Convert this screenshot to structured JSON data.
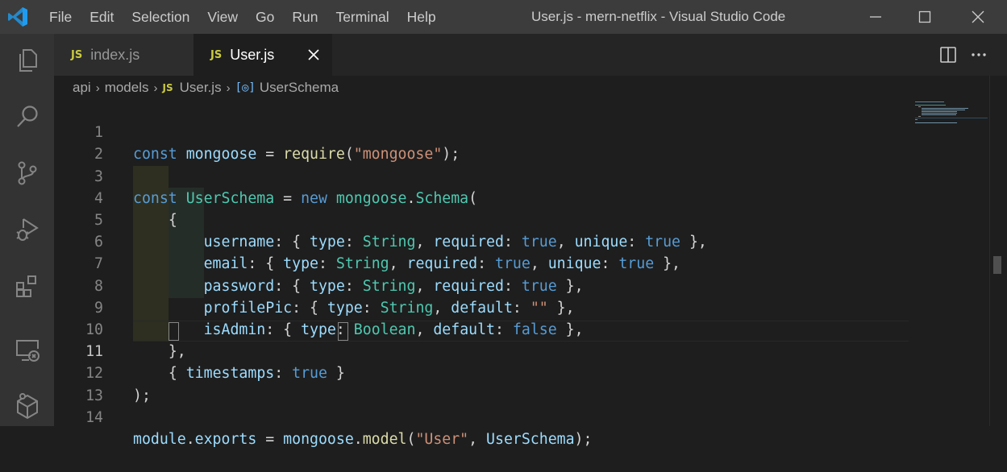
{
  "titlebar": {
    "menu": [
      "File",
      "Edit",
      "Selection",
      "View",
      "Go",
      "Run",
      "Terminal",
      "Help"
    ],
    "window_title": "User.js - mern-netflix - Visual Studio Code"
  },
  "activity_bar": [
    "explorer-icon",
    "search-icon",
    "source-control-icon",
    "run-debug-icon",
    "extensions-icon",
    "remote-explorer-icon",
    "docker-icon"
  ],
  "tabs": [
    {
      "icon": "JS",
      "label": "index.js",
      "active": false
    },
    {
      "icon": "JS",
      "label": "User.js",
      "active": true
    }
  ],
  "breadcrumb": {
    "folder1": "api",
    "folder2": "models",
    "file_icon": "JS",
    "file": "User.js",
    "symbol_icon": "[◎]",
    "symbol": "UserSchema"
  },
  "editor": {
    "current_line": 11,
    "lines": [
      {
        "n": "1",
        "text": "const mongoose = require(\"mongoose\");"
      },
      {
        "n": "2",
        "text": ""
      },
      {
        "n": "3",
        "text": "const UserSchema = new mongoose.Schema("
      },
      {
        "n": "4",
        "text": "    {"
      },
      {
        "n": "5",
        "text": "        username: { type: String, required: true, unique: true },"
      },
      {
        "n": "6",
        "text": "        email: { type: String, required: true, unique: true },"
      },
      {
        "n": "7",
        "text": "        password: { type: String, required: true },"
      },
      {
        "n": "8",
        "text": "        profilePic: { type: String, default: \"\" },"
      },
      {
        "n": "9",
        "text": "        isAdmin: { type: Boolean, default: false },"
      },
      {
        "n": "10",
        "text": "    },"
      },
      {
        "n": "11",
        "text": "    { timestamps: true }"
      },
      {
        "n": "12",
        "text": ");"
      },
      {
        "n": "13",
        "text": ""
      },
      {
        "n": "14",
        "text": "module.exports = mongoose.model(\"User\", UserSchema);"
      }
    ]
  },
  "colors": {
    "keyword": "#569cd6",
    "variable": "#9cdcfe",
    "class": "#4ec9b0",
    "function": "#dcdcaa",
    "string": "#ce9178",
    "js_icon": "#cbcb41"
  }
}
